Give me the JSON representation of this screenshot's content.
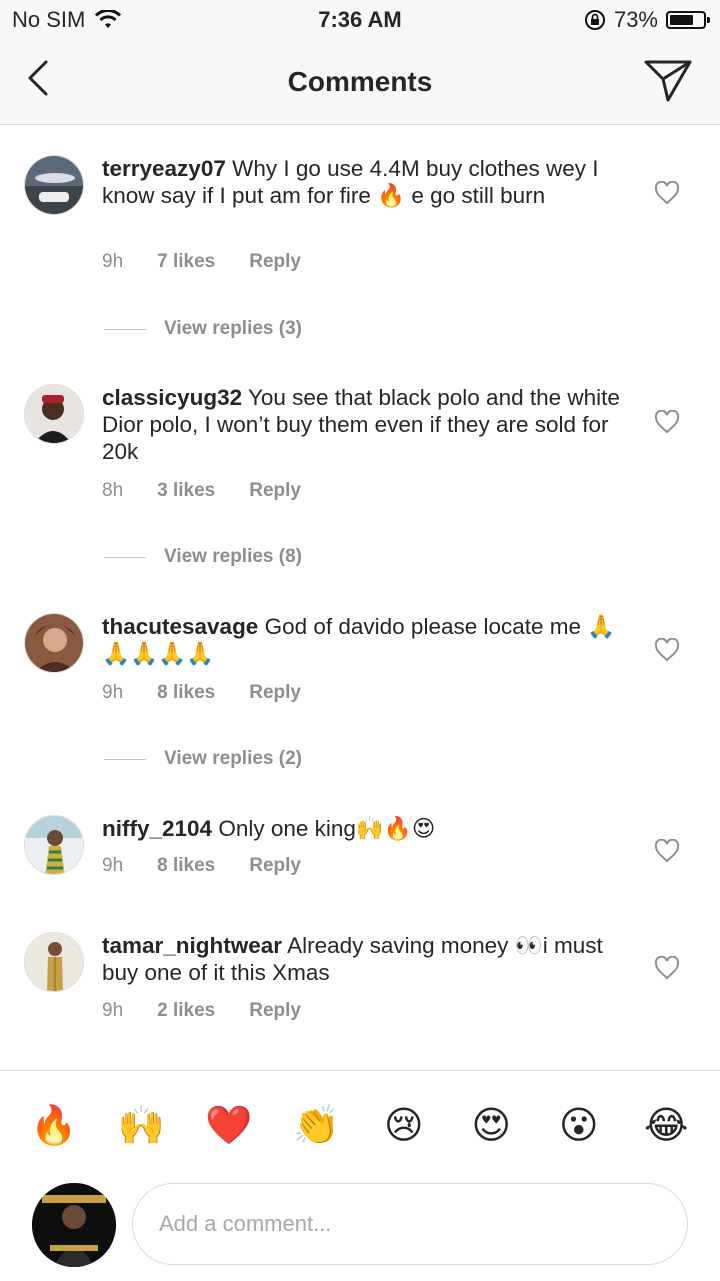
{
  "status_bar": {
    "carrier": "No SIM",
    "time": "7:36 AM",
    "battery": "73%",
    "battery_level": 0.73
  },
  "header": {
    "title": "Comments"
  },
  "comments": [
    {
      "user": "terryeazy07",
      "text": " Why I go use 4.4M buy clothes wey I know say if I put am for fire 🔥 e go still burn",
      "time": "9h",
      "likes": "7 likes",
      "reply": "Reply",
      "view_replies": "View replies (3)"
    },
    {
      "user": "classicyug32",
      "text": " You see that black polo and the white Dior polo, I won’t buy them even if they are sold for 20k",
      "time": "8h",
      "likes": "3 likes",
      "reply": "Reply",
      "view_replies": "View replies (8)"
    },
    {
      "user": "thacutesavage",
      "text": " God of davido please locate me 🙏🙏🙏🙏🙏",
      "time": "9h",
      "likes": "8 likes",
      "reply": "Reply",
      "view_replies": "View replies (2)"
    },
    {
      "user": "niffy_2104",
      "text": " Only one king🙌🔥😍",
      "time": "9h",
      "likes": "8 likes",
      "reply": "Reply"
    },
    {
      "user": "tamar_nightwear",
      "text": " Already saving money 👀i must buy one of it this Xmas",
      "time": "9h",
      "likes": "2 likes",
      "reply": "Reply"
    }
  ],
  "emoji_bar": [
    "🔥",
    "🙌",
    "❤️",
    "👏",
    "😢",
    "😍",
    "😮",
    "😂"
  ],
  "composer": {
    "placeholder": "Add a comment..."
  },
  "colors": {
    "text": "#262626",
    "secondary": "#8e8e8e",
    "divider": "#dbdbdb"
  }
}
